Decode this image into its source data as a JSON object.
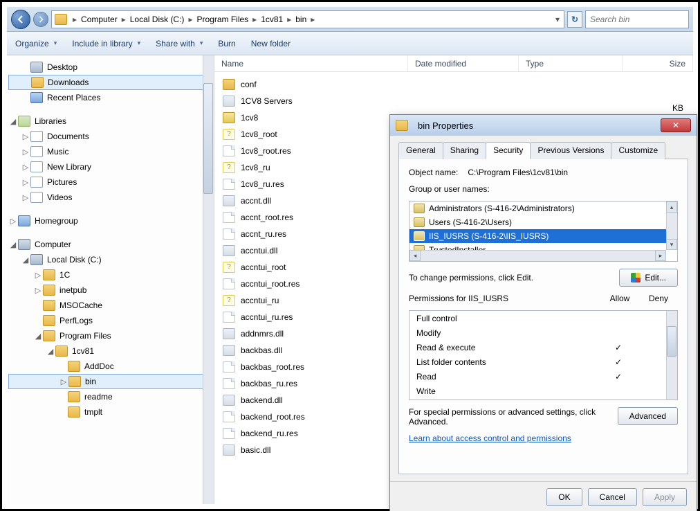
{
  "breadcrumb": [
    "Computer",
    "Local Disk (C:)",
    "Program Files",
    "1cv81",
    "bin"
  ],
  "search_placeholder": "Search bin",
  "toolbar": {
    "organize": "Organize",
    "include": "Include in library",
    "share": "Share with",
    "burn": "Burn",
    "newfolder": "New folder"
  },
  "columns": {
    "name": "Name",
    "date": "Date modified",
    "type": "Type",
    "size": "Size"
  },
  "tree": {
    "desktop": "Desktop",
    "downloads": "Downloads",
    "recent": "Recent Places",
    "libraries": "Libraries",
    "documents": "Documents",
    "music": "Music",
    "newlib": "New Library",
    "pictures": "Pictures",
    "videos": "Videos",
    "homegroup": "Homegroup",
    "computer": "Computer",
    "localdisk": "Local Disk (C:)",
    "f_1c": "1C",
    "f_inetpub": "inetpub",
    "f_msocache": "MSOCache",
    "f_perflogs": "PerfLogs",
    "f_programfiles": "Program Files",
    "f_1cv81": "1cv81",
    "f_adddoc": "AddDoc",
    "f_bin": "bin",
    "f_readme": "readme",
    "f_tmplt": "tmplt"
  },
  "files": [
    {
      "name": "conf",
      "icon": "folder"
    },
    {
      "name": "1CV8 Servers",
      "icon": "dll"
    },
    {
      "name": "1cv8",
      "icon": "ico"
    },
    {
      "name": "1cv8_root",
      "icon": "q"
    },
    {
      "name": "1cv8_root.res",
      "icon": "file"
    },
    {
      "name": "1cv8_ru",
      "icon": "q"
    },
    {
      "name": "1cv8_ru.res",
      "icon": "file"
    },
    {
      "name": "accnt.dll",
      "icon": "dll"
    },
    {
      "name": "accnt_root.res",
      "icon": "file"
    },
    {
      "name": "accnt_ru.res",
      "icon": "file"
    },
    {
      "name": "accntui.dll",
      "icon": "dll"
    },
    {
      "name": "accntui_root",
      "icon": "q"
    },
    {
      "name": "accntui_root.res",
      "icon": "file"
    },
    {
      "name": "accntui_ru",
      "icon": "q"
    },
    {
      "name": "accntui_ru.res",
      "icon": "file"
    },
    {
      "name": "addnmrs.dll",
      "icon": "dll"
    },
    {
      "name": "backbas.dll",
      "icon": "dll"
    },
    {
      "name": "backbas_root.res",
      "icon": "file"
    },
    {
      "name": "backbas_ru.res",
      "icon": "file"
    },
    {
      "name": "backend.dll",
      "icon": "dll"
    },
    {
      "name": "backend_root.res",
      "icon": "file"
    },
    {
      "name": "backend_ru.res",
      "icon": "file"
    },
    {
      "name": "basic.dll",
      "icon": "dll"
    }
  ],
  "size_kb_label": "KB",
  "dialog": {
    "title": "bin Properties",
    "tabs": {
      "general": "General",
      "sharing": "Sharing",
      "security": "Security",
      "prev": "Previous Versions",
      "cust": "Customize"
    },
    "object_name_lbl": "Object name:",
    "object_name": "C:\\Program Files\\1cv81\\bin",
    "group_lbl": "Group or user names:",
    "groups": [
      "Administrators (S-416-2\\Administrators)",
      "Users (S-416-2\\Users)",
      "IIS_IUSRS (S-416-2\\IIS_IUSRS)",
      "TrustedInstaller"
    ],
    "selected_group_index": 2,
    "change_hint": "To change permissions, click Edit.",
    "edit_btn": "Edit...",
    "perm_for": "Permissions for IIS_IUSRS",
    "allow": "Allow",
    "deny": "Deny",
    "perms": [
      {
        "name": "Full control",
        "allow": false,
        "deny": false
      },
      {
        "name": "Modify",
        "allow": false,
        "deny": false
      },
      {
        "name": "Read & execute",
        "allow": true,
        "deny": false
      },
      {
        "name": "List folder contents",
        "allow": true,
        "deny": false
      },
      {
        "name": "Read",
        "allow": true,
        "deny": false
      },
      {
        "name": "Write",
        "allow": false,
        "deny": false
      }
    ],
    "adv_hint": "For special permissions or advanced settings, click Advanced.",
    "adv_btn": "Advanced",
    "learn": "Learn about access control and permissions",
    "ok": "OK",
    "cancel": "Cancel",
    "apply": "Apply"
  }
}
